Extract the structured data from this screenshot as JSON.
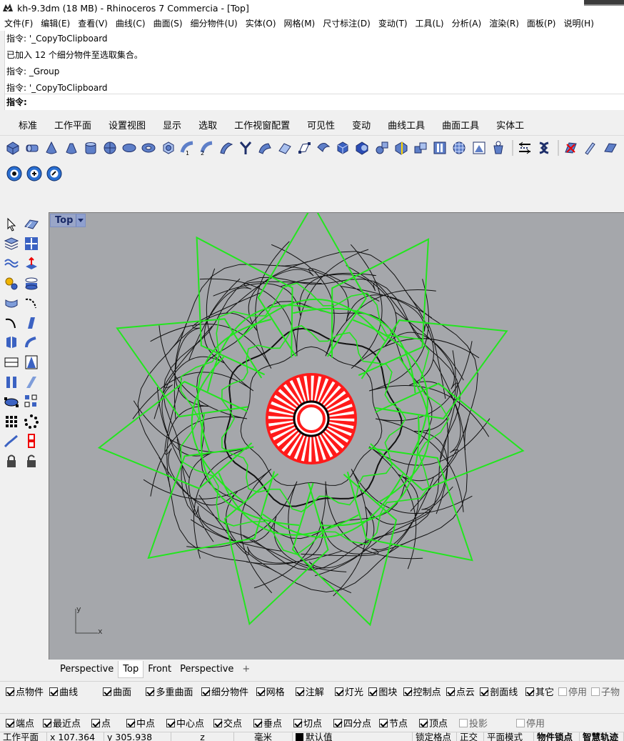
{
  "titlebar": {
    "title": "kh-9.3dm (18 MB) - Rhinoceros 7 Commercia - [Top]"
  },
  "menu": [
    "文件(F)",
    "编辑(E)",
    "查看(V)",
    "曲线(C)",
    "曲面(S)",
    "细分物件(U)",
    "实体(O)",
    "网格(M)",
    "尺寸标注(D)",
    "变动(T)",
    "工具(L)",
    "分析(A)",
    "渲染(R)",
    "面板(P)",
    "说明(H)"
  ],
  "command_history": [
    "指令: '_CopyToClipboard",
    "已加入 12 个细分物件至选取集合。",
    "指令: _Group",
    "指令: '_CopyToClipboard"
  ],
  "command_prompt": "指令:",
  "toolbar_tabs": [
    "标准",
    "工作平面",
    "设置视图",
    "显示",
    "选取",
    "工作视窗配置",
    "可见性",
    "变动",
    "曲线工具",
    "曲面工具",
    "实体工"
  ],
  "viewport": {
    "name": "Top",
    "axis_y": "y",
    "axis_x": "x"
  },
  "viewport_tabs": [
    "Perspective",
    "Top",
    "Front",
    "Perspective",
    "+"
  ],
  "filters": [
    {
      "label": "点物件",
      "checked": true
    },
    {
      "label": "曲线",
      "checked": true
    },
    {
      "label": "曲面",
      "checked": true
    },
    {
      "label": "多重曲面",
      "checked": true
    },
    {
      "label": "细分物件",
      "checked": true
    },
    {
      "label": "网格",
      "checked": true
    },
    {
      "label": "注解",
      "checked": true
    },
    {
      "label": "灯光",
      "checked": true
    },
    {
      "label": "图块",
      "checked": true
    },
    {
      "label": "控制点",
      "checked": true
    },
    {
      "label": "点云",
      "checked": true
    },
    {
      "label": "剖面线",
      "checked": true
    },
    {
      "label": "其它",
      "checked": true
    },
    {
      "label": "停用",
      "checked": false
    },
    {
      "label": "子物",
      "checked": false
    }
  ],
  "osnaps": [
    {
      "label": "端点",
      "checked": true
    },
    {
      "label": "最近点",
      "checked": true
    },
    {
      "label": "点",
      "checked": true
    },
    {
      "label": "中点",
      "checked": true
    },
    {
      "label": "中心点",
      "checked": true
    },
    {
      "label": "交点",
      "checked": true
    },
    {
      "label": "垂点",
      "checked": true
    },
    {
      "label": "切点",
      "checked": true
    },
    {
      "label": "四分点",
      "checked": true
    },
    {
      "label": "节点",
      "checked": true
    },
    {
      "label": "顶点",
      "checked": true
    },
    {
      "label": "投影",
      "checked": false
    },
    {
      "label": "停用",
      "checked": false
    }
  ],
  "status": {
    "cplane": "工作平面",
    "x": "x 107.364",
    "y": "y 305.938",
    "z": "z",
    "units": "毫米",
    "layer": "默认值",
    "grid_snap": "锁定格点",
    "ortho": "正交",
    "planar": "平面模式",
    "osnap": "物件锁点",
    "smarttrack": "智慧轨迹"
  },
  "colors": {
    "viewport_bg": "#a5a7ab",
    "wire_green": "#22e61e",
    "wire_black": "#111111",
    "highlight_red": "#ff1a1a"
  }
}
